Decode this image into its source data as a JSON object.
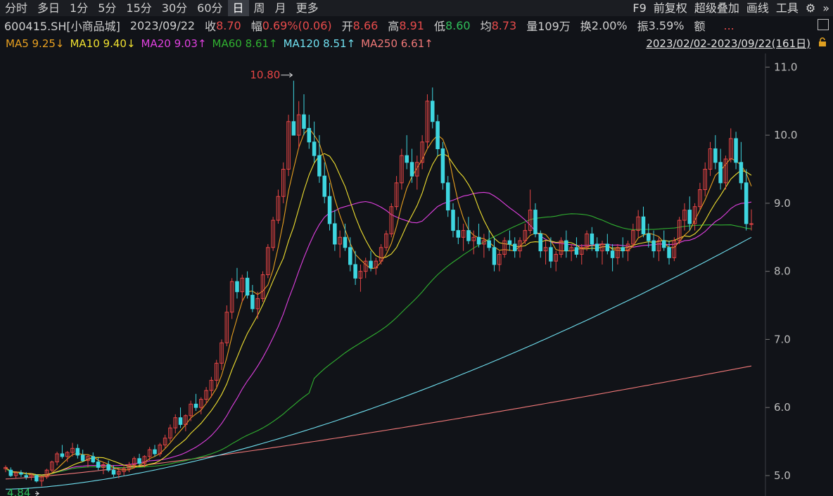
{
  "toolbar": {
    "tabs": [
      "分时",
      "多日",
      "1分",
      "5分",
      "15分",
      "30分",
      "60分",
      "日",
      "周",
      "月",
      "更多"
    ],
    "active_tab": "日",
    "tools": [
      "F9",
      "前复权",
      "超级叠加",
      "画线",
      "工具"
    ]
  },
  "info": {
    "code": "600415.SH[小商品城]",
    "date": "2023/09/22",
    "close_label": "收",
    "close": "8.70",
    "change_label": "幅",
    "change": "0.69%(0.06)",
    "open_label": "开",
    "open": "8.66",
    "high_label": "高",
    "high": "8.91",
    "low_label": "低",
    "low": "8.60",
    "avg_label": "均",
    "avg": "8.73",
    "vol_label": "量",
    "vol": "109万",
    "turnover_label": "换",
    "turnover": "2.00%",
    "amp_label": "振",
    "amp": "3.59%",
    "amount_label": "额",
    "more": "..."
  },
  "ma": {
    "ma5": "MA5 9.25↓",
    "ma10": "MA10 9.40↓",
    "ma20": "MA20 9.03↑",
    "ma60": "MA60 8.61↑",
    "ma120": "MA120 8.51↑",
    "ma250": "MA250 6.61↑"
  },
  "range": "2023/02/02-2023/09/22(161日)",
  "colors": {
    "up": "#e64545",
    "down": "#3ed6e0",
    "ma5": "#e8a020",
    "ma10": "#f0e030",
    "ma20": "#e040e0",
    "ma60": "#30b030",
    "ma120": "#70e0f0",
    "ma250": "#f07878"
  },
  "chart_data": {
    "type": "candlestick",
    "title": "",
    "ylim": [
      4.7,
      11.2
    ],
    "yticks": [
      "11.0",
      "10.0",
      "9.0",
      "8.0",
      "7.0",
      "6.0",
      "5.0"
    ],
    "ytick_values": [
      11.0,
      10.0,
      9.0,
      8.0,
      7.0,
      6.0,
      5.0
    ],
    "annotations": {
      "high": "10.80",
      "low": "4.84"
    },
    "count": 161,
    "candles": [
      [
        5.1,
        5.15,
        5.05,
        5.12
      ],
      [
        5.08,
        5.12,
        4.98,
        5.0
      ],
      [
        5.0,
        5.06,
        4.96,
        5.04
      ],
      [
        5.04,
        5.08,
        4.98,
        5.02
      ],
      [
        5.0,
        5.05,
        4.94,
        4.98
      ],
      [
        4.98,
        5.03,
        4.93,
        5.01
      ],
      [
        5.0,
        5.02,
        4.9,
        4.92
      ],
      [
        4.92,
        5.0,
        4.84,
        4.98
      ],
      [
        4.98,
        5.1,
        4.95,
        5.08
      ],
      [
        5.08,
        5.22,
        5.05,
        5.2
      ],
      [
        5.2,
        5.35,
        5.15,
        5.32
      ],
      [
        5.32,
        5.45,
        5.25,
        5.28
      ],
      [
        5.28,
        5.36,
        5.2,
        5.34
      ],
      [
        5.34,
        5.48,
        5.28,
        5.4
      ],
      [
        5.4,
        5.46,
        5.25,
        5.3
      ],
      [
        5.3,
        5.38,
        5.2,
        5.22
      ],
      [
        5.22,
        5.3,
        5.12,
        5.28
      ],
      [
        5.28,
        5.34,
        5.18,
        5.2
      ],
      [
        5.2,
        5.26,
        5.08,
        5.12
      ],
      [
        5.12,
        5.2,
        5.02,
        5.16
      ],
      [
        5.16,
        5.22,
        5.05,
        5.08
      ],
      [
        5.08,
        5.15,
        4.98,
        5.02
      ],
      [
        5.02,
        5.1,
        4.96,
        5.06
      ],
      [
        5.06,
        5.14,
        5.0,
        5.1
      ],
      [
        5.1,
        5.2,
        5.05,
        5.16
      ],
      [
        5.16,
        5.28,
        5.1,
        5.25
      ],
      [
        5.25,
        5.32,
        5.15,
        5.18
      ],
      [
        5.18,
        5.3,
        5.12,
        5.28
      ],
      [
        5.28,
        5.42,
        5.22,
        5.38
      ],
      [
        5.38,
        5.45,
        5.28,
        5.32
      ],
      [
        5.32,
        5.48,
        5.28,
        5.45
      ],
      [
        5.45,
        5.6,
        5.4,
        5.55
      ],
      [
        5.55,
        5.75,
        5.5,
        5.7
      ],
      [
        5.7,
        5.9,
        5.62,
        5.85
      ],
      [
        5.85,
        6.0,
        5.7,
        5.75
      ],
      [
        5.75,
        5.9,
        5.65,
        5.88
      ],
      [
        5.88,
        6.1,
        5.8,
        6.05
      ],
      [
        6.05,
        6.2,
        5.95,
        6.0
      ],
      [
        6.0,
        6.15,
        5.9,
        6.12
      ],
      [
        6.12,
        6.3,
        6.05,
        6.25
      ],
      [
        6.25,
        6.45,
        6.15,
        6.4
      ],
      [
        6.4,
        6.7,
        6.3,
        6.65
      ],
      [
        6.65,
        7.0,
        6.55,
        6.95
      ],
      [
        6.95,
        7.5,
        6.9,
        7.4
      ],
      [
        7.4,
        7.9,
        7.3,
        7.85
      ],
      [
        7.85,
        8.05,
        7.6,
        7.7
      ],
      [
        7.7,
        7.95,
        7.55,
        7.9
      ],
      [
        7.9,
        8.0,
        7.6,
        7.65
      ],
      [
        7.65,
        7.8,
        7.4,
        7.45
      ],
      [
        7.45,
        7.7,
        7.3,
        7.6
      ],
      [
        7.6,
        8.0,
        7.55,
        7.95
      ],
      [
        7.95,
        8.4,
        7.9,
        8.35
      ],
      [
        8.35,
        8.8,
        8.3,
        8.75
      ],
      [
        8.75,
        9.2,
        8.7,
        9.1
      ],
      [
        9.1,
        9.6,
        9.0,
        9.5
      ],
      [
        9.5,
        10.3,
        9.4,
        10.2
      ],
      [
        10.2,
        10.8,
        10.1,
        10.0
      ],
      [
        10.0,
        10.5,
        9.8,
        10.3
      ],
      [
        10.3,
        10.6,
        10.0,
        10.1
      ],
      [
        10.1,
        10.3,
        9.8,
        9.9
      ],
      [
        9.9,
        10.2,
        9.6,
        9.7
      ],
      [
        9.7,
        10.0,
        9.3,
        9.4
      ],
      [
        9.4,
        9.6,
        9.0,
        9.1
      ],
      [
        9.1,
        9.3,
        8.6,
        8.7
      ],
      [
        8.7,
        8.9,
        8.3,
        8.4
      ],
      [
        8.4,
        8.6,
        8.2,
        8.5
      ],
      [
        8.5,
        8.7,
        8.3,
        8.35
      ],
      [
        8.35,
        8.5,
        8.0,
        8.1
      ],
      [
        8.1,
        8.3,
        7.8,
        7.9
      ],
      [
        7.9,
        8.1,
        7.7,
        8.0
      ],
      [
        8.0,
        8.2,
        7.9,
        8.15
      ],
      [
        8.15,
        8.3,
        8.0,
        8.05
      ],
      [
        8.05,
        8.2,
        7.95,
        8.15
      ],
      [
        8.15,
        8.4,
        8.1,
        8.35
      ],
      [
        8.35,
        8.6,
        8.3,
        8.55
      ],
      [
        8.55,
        9.0,
        8.5,
        8.95
      ],
      [
        8.95,
        9.4,
        8.9,
        9.3
      ],
      [
        9.3,
        9.8,
        9.2,
        9.7
      ],
      [
        9.7,
        10.0,
        9.5,
        9.6
      ],
      [
        9.6,
        9.8,
        9.3,
        9.4
      ],
      [
        9.4,
        9.7,
        9.2,
        9.6
      ],
      [
        9.6,
        10.0,
        9.5,
        9.9
      ],
      [
        9.9,
        10.6,
        9.8,
        10.5
      ],
      [
        10.5,
        10.7,
        10.1,
        10.2
      ],
      [
        10.2,
        10.3,
        9.7,
        9.8
      ],
      [
        9.8,
        9.9,
        9.2,
        9.3
      ],
      [
        9.3,
        9.4,
        8.8,
        8.9
      ],
      [
        8.9,
        9.0,
        8.5,
        8.6
      ],
      [
        8.6,
        8.8,
        8.4,
        8.5
      ],
      [
        8.5,
        8.7,
        8.3,
        8.6
      ],
      [
        8.6,
        8.8,
        8.4,
        8.45
      ],
      [
        8.45,
        8.6,
        8.25,
        8.5
      ],
      [
        8.5,
        8.7,
        8.35,
        8.4
      ],
      [
        8.4,
        8.55,
        8.2,
        8.45
      ],
      [
        8.45,
        8.6,
        8.3,
        8.35
      ],
      [
        8.35,
        8.5,
        8.0,
        8.1
      ],
      [
        8.1,
        8.3,
        8.0,
        8.25
      ],
      [
        8.25,
        8.5,
        8.2,
        8.45
      ],
      [
        8.45,
        8.6,
        8.3,
        8.4
      ],
      [
        8.4,
        8.5,
        8.2,
        8.3
      ],
      [
        8.3,
        8.5,
        8.2,
        8.45
      ],
      [
        8.45,
        8.7,
        8.4,
        8.6
      ],
      [
        8.6,
        9.2,
        8.55,
        8.9
      ],
      [
        8.9,
        9.0,
        8.5,
        8.55
      ],
      [
        8.55,
        8.6,
        8.2,
        8.3
      ],
      [
        8.3,
        8.45,
        8.1,
        8.35
      ],
      [
        8.35,
        8.5,
        8.05,
        8.15
      ],
      [
        8.15,
        8.3,
        8.0,
        8.25
      ],
      [
        8.25,
        8.5,
        8.2,
        8.45
      ],
      [
        8.45,
        8.6,
        8.2,
        8.3
      ],
      [
        8.3,
        8.4,
        8.15,
        8.35
      ],
      [
        8.35,
        8.5,
        8.2,
        8.25
      ],
      [
        8.25,
        8.4,
        8.1,
        8.35
      ],
      [
        8.35,
        8.6,
        8.3,
        8.55
      ],
      [
        8.55,
        8.65,
        8.3,
        8.4
      ],
      [
        8.4,
        8.5,
        8.2,
        8.3
      ],
      [
        8.3,
        8.45,
        8.1,
        8.4
      ],
      [
        8.4,
        8.55,
        8.25,
        8.3
      ],
      [
        8.3,
        8.4,
        8.0,
        8.2
      ],
      [
        8.2,
        8.4,
        8.1,
        8.35
      ],
      [
        8.35,
        8.5,
        8.2,
        8.3
      ],
      [
        8.3,
        8.45,
        8.15,
        8.4
      ],
      [
        8.4,
        8.7,
        8.35,
        8.6
      ],
      [
        8.6,
        8.9,
        8.5,
        8.8
      ],
      [
        8.8,
        8.95,
        8.5,
        8.55
      ],
      [
        8.55,
        8.7,
        8.35,
        8.45
      ],
      [
        8.45,
        8.6,
        8.2,
        8.3
      ],
      [
        8.3,
        8.5,
        8.15,
        8.45
      ],
      [
        8.45,
        8.6,
        8.3,
        8.35
      ],
      [
        8.35,
        8.45,
        8.1,
        8.2
      ],
      [
        8.2,
        8.5,
        8.15,
        8.45
      ],
      [
        8.45,
        8.8,
        8.4,
        8.75
      ],
      [
        8.75,
        9.0,
        8.6,
        8.9
      ],
      [
        8.9,
        9.1,
        8.6,
        8.7
      ],
      [
        8.7,
        9.0,
        8.6,
        8.95
      ],
      [
        8.95,
        9.3,
        8.9,
        9.2
      ],
      [
        9.2,
        9.6,
        9.1,
        9.5
      ],
      [
        9.5,
        9.9,
        9.4,
        9.8
      ],
      [
        9.8,
        10.0,
        9.5,
        9.6
      ],
      [
        9.6,
        9.8,
        9.2,
        9.3
      ],
      [
        9.3,
        9.7,
        9.2,
        9.65
      ],
      [
        9.65,
        10.1,
        9.6,
        9.95
      ],
      [
        9.95,
        10.05,
        9.5,
        9.6
      ],
      [
        9.6,
        9.9,
        9.2,
        9.3
      ],
      [
        9.3,
        9.5,
        8.6,
        8.7
      ],
      [
        8.7,
        8.91,
        8.6,
        8.7
      ]
    ]
  }
}
